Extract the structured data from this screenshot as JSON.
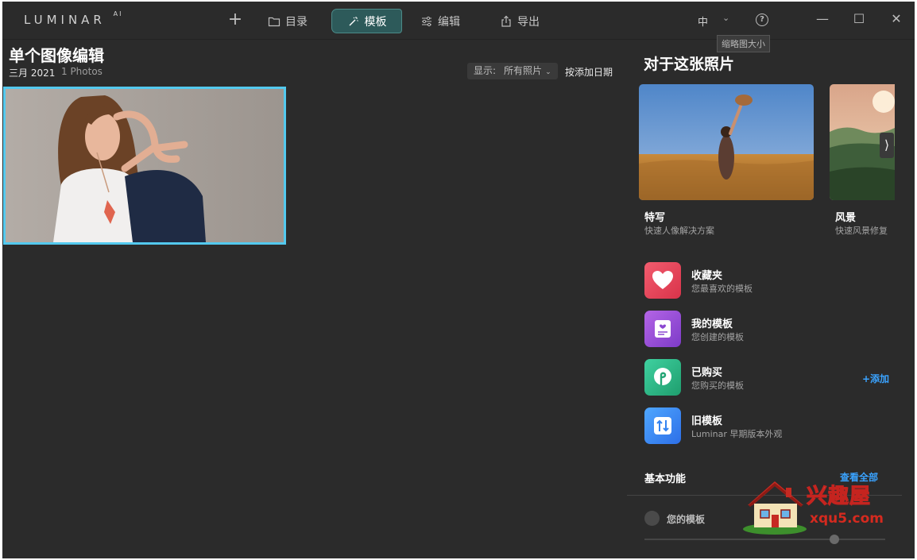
{
  "app": {
    "logo": "LUMINAR",
    "logo_suffix": "AI"
  },
  "topbar": {
    "add_label": "+",
    "nav": [
      {
        "label": "目录",
        "icon": "folder-icon"
      },
      {
        "label": "模板",
        "icon": "magic-wand-icon",
        "active": true
      },
      {
        "label": "编辑",
        "icon": "sliders-icon"
      },
      {
        "label": "导出",
        "icon": "share-icon"
      }
    ],
    "language": "中",
    "help": "?",
    "tooltip": "缩略图大小",
    "window": {
      "min": "—",
      "max": "☐",
      "close": "✕"
    }
  },
  "main": {
    "title": "单个图像编辑",
    "date": "三月 2021",
    "count": "1 Photos",
    "filter_label": "显示:",
    "filter_value": "所有照片",
    "sort_label": "按添加日期"
  },
  "panel": {
    "title": "对于这张照片",
    "cards": [
      {
        "name": "特写",
        "sub": "快速人像解决方案"
      },
      {
        "name": "风景",
        "sub": "快速风景修复"
      }
    ],
    "collections": [
      {
        "name": "收藏夹",
        "sub": "您最喜欢的模板",
        "icon": "heart-icon"
      },
      {
        "name": "我的模板",
        "sub": "您创建的模板",
        "icon": "template-card-icon"
      },
      {
        "name": "已购买",
        "sub": "您购买的模板",
        "icon": "store-icon"
      },
      {
        "name": "旧模板",
        "sub": "Luminar 早期版本外观",
        "icon": "swap-icon"
      }
    ],
    "add_label": "+添加",
    "section_title": "基本功能",
    "see_all": "查看全部",
    "radio_label": "您的模板"
  },
  "watermark": {
    "text": "兴趣屋",
    "url": "xqu5.com"
  },
  "colors": {
    "background": "#2b2b2b",
    "accent_selection": "#53c9ee",
    "active_tab": "#2d5a5a",
    "link": "#3aa3ff"
  }
}
